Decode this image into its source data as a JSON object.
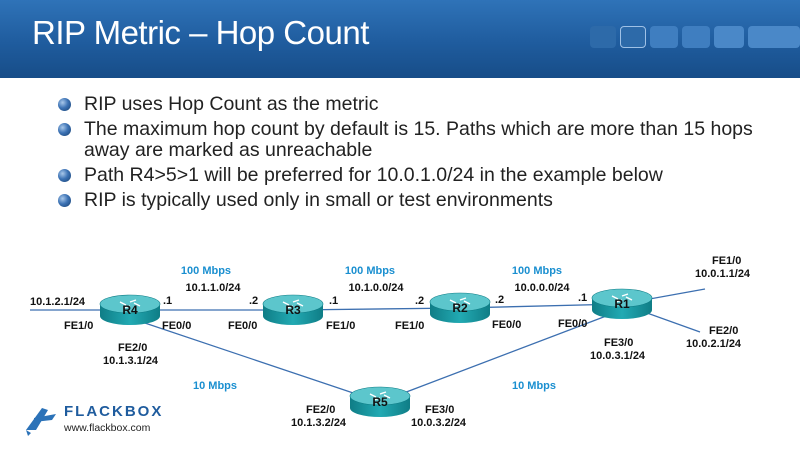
{
  "slide": {
    "title": "RIP Metric – Hop Count",
    "bullets": [
      "RIP uses Hop Count as the metric",
      "The maximum hop count by default is 15. Paths which are more than 15 hops away are marked as unreachable",
      "Path R4>5>1 will be preferred for 10.0.1.0/24 in the example below",
      "RIP is typically used only in small or test environments"
    ]
  },
  "diagram": {
    "routers": {
      "r4": "R4",
      "r3": "R3",
      "r2": "R2",
      "r1": "R1",
      "r5": "R5"
    },
    "links": {
      "r4_r3_speed": "100 Mbps",
      "r4_r3_net": "10.1.1.0/24",
      "r3_r2_speed": "100 Mbps",
      "r3_r2_net": "10.1.0.0/24",
      "r2_r1_speed": "100 Mbps",
      "r2_r1_net": "10.0.0.0/24",
      "r4_r5_speed": "10 Mbps",
      "r5_r1_speed": "10 Mbps"
    },
    "labels": {
      "r4_left_net": "10.1.2.1/24",
      "r4_fe10": "FE1/0",
      "r4_dot1": ".1",
      "r4_fe00": "FE0/0",
      "r4_fe20": "FE2/0",
      "r4_fe20_ip": "10.1.3.1/24",
      "r3_dot2": ".2",
      "r3_dot1": ".1",
      "r3_fe00": "FE0/0",
      "r3_fe10": "FE1/0",
      "r2_dot2_left": ".2",
      "r2_dot2_right": ".2",
      "r2_fe10": "FE1/0",
      "r2_fe00": "FE0/0",
      "r1_dot1": ".1",
      "r1_fe00": "FE0/0",
      "r1_fe10": "FE1/0",
      "r1_fe10_ip": "10.0.1.1/24",
      "r1_fe20": "FE2/0",
      "r1_fe20_ip": "10.0.2.1/24",
      "r1_fe30": "FE3/0",
      "r1_fe30_ip": "10.0.3.1/24",
      "r5_fe20": "FE2/0",
      "r5_fe20_ip": "10.1.3.2/24",
      "r5_fe30": "FE3/0",
      "r5_fe30_ip": "10.0.3.2/24"
    }
  },
  "logo": {
    "brand": "FLACKBOX",
    "url": "www.flackbox.com"
  },
  "colors": {
    "header": "#1f5c9e",
    "link_speed": "#1a8fd0",
    "router": "#1a9ea6"
  }
}
